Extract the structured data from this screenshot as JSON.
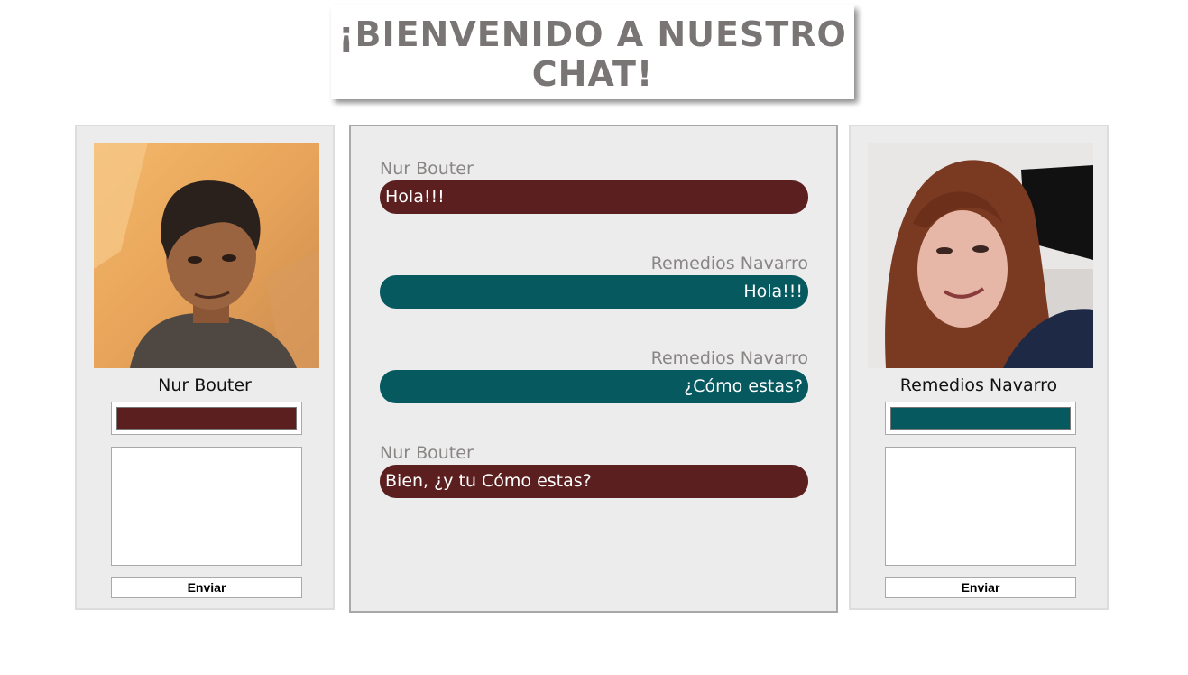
{
  "header": {
    "title_line1": "¡BIENVENIDO A NUESTRO",
    "title_line2": "CHAT!"
  },
  "colors": {
    "user1": "#5c1f1f",
    "user2": "#06595f",
    "panel_bg": "#ececec",
    "title_text": "#7a7575"
  },
  "left_user": {
    "name": "Nur Bouter",
    "color": "#5c1f1f",
    "message_value": "",
    "send_label": "Enviar",
    "avatar_icon": "user-photo-male"
  },
  "right_user": {
    "name": "Remedios Navarro",
    "color": "#06595f",
    "message_value": "",
    "send_label": "Enviar",
    "avatar_icon": "user-photo-female"
  },
  "chat": {
    "messages": [
      {
        "sender": "Nur Bouter",
        "text": "Hola!!!",
        "side": "left"
      },
      {
        "sender": "Remedios Navarro",
        "text": "Hola!!!",
        "side": "right"
      },
      {
        "sender": "Remedios Navarro",
        "text": "¿Cómo estas?",
        "side": "right"
      },
      {
        "sender": "Nur Bouter",
        "text": "Bien, ¿y tu Cómo estas?",
        "side": "left"
      }
    ]
  }
}
